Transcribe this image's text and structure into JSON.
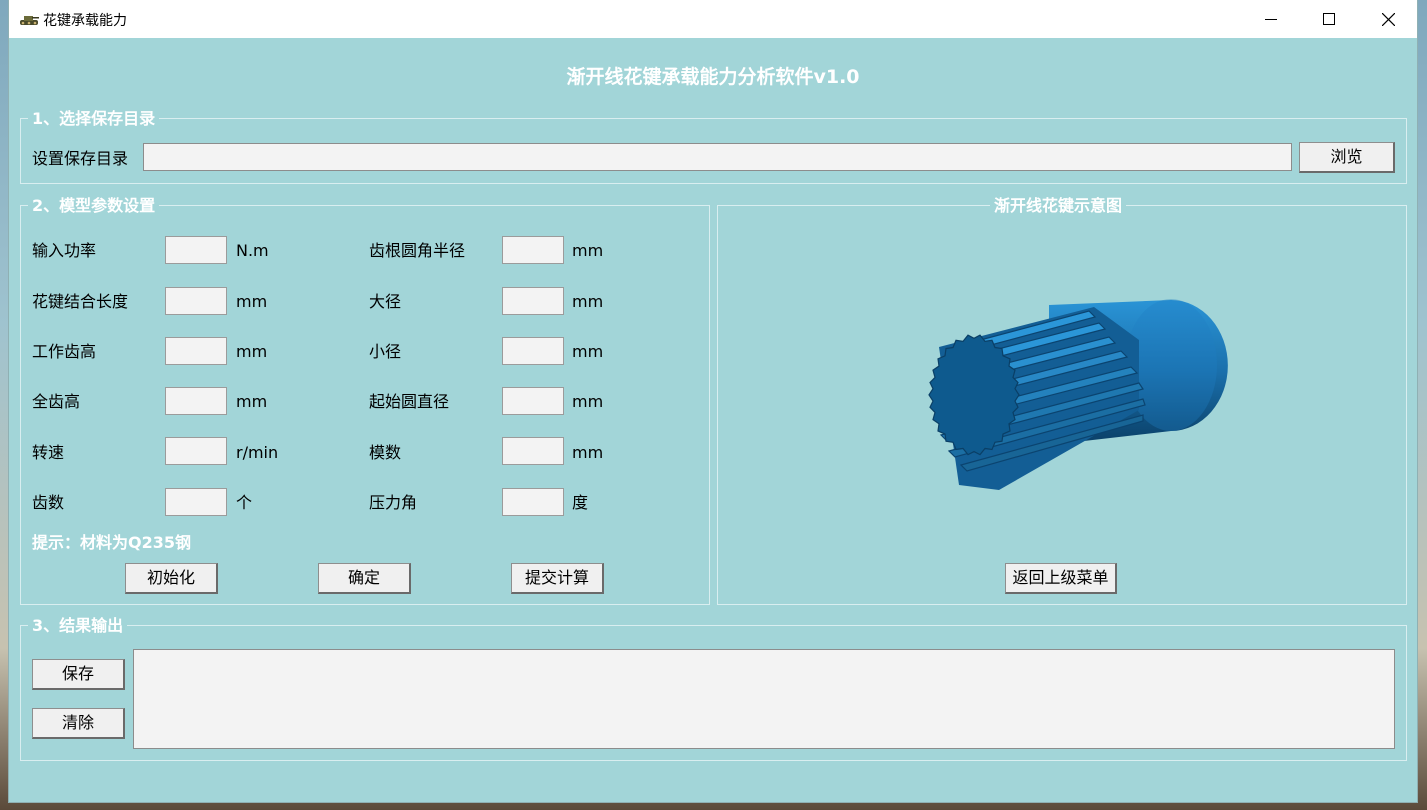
{
  "window": {
    "title": "花键承载能力",
    "controls": [
      "minimize-icon",
      "maximize-icon",
      "close-icon"
    ]
  },
  "header": {
    "title": "渐开线花键承载能力分析软件v1.0"
  },
  "section1": {
    "title": "1、选择保存目录",
    "dir_label": "设置保存目录",
    "dir_value": "",
    "browse_label": "浏览"
  },
  "section2": {
    "title": "2、模型参数设置",
    "left_params": [
      {
        "label": "输入功率",
        "unit": "N.m",
        "value": ""
      },
      {
        "label": "花键结合长度",
        "unit": "mm",
        "value": ""
      },
      {
        "label": "工作齿高",
        "unit": "mm",
        "value": ""
      },
      {
        "label": "全齿高",
        "unit": "mm",
        "value": ""
      },
      {
        "label": "转速",
        "unit": "r/min",
        "value": ""
      },
      {
        "label": "齿数",
        "unit": "个",
        "value": ""
      }
    ],
    "right_params": [
      {
        "label": "齿根圆角半径",
        "unit": "mm",
        "value": ""
      },
      {
        "label": "大径",
        "unit": "mm",
        "value": ""
      },
      {
        "label": "小径",
        "unit": "mm",
        "value": ""
      },
      {
        "label": "起始圆直径",
        "unit": "mm",
        "value": ""
      },
      {
        "label": "模数",
        "unit": "mm",
        "value": ""
      },
      {
        "label": "压力角",
        "unit": "度",
        "value": ""
      }
    ],
    "hint": "提示：材料为Q235钢",
    "buttons": {
      "init": "初始化",
      "confirm": "确定",
      "submit": "提交计算"
    }
  },
  "diagram": {
    "title": "渐开线花键示意图",
    "back_label": "返回上级菜单",
    "colors": {
      "shaft": "#1f7fc4",
      "shaft_dark": "#0d4f7e",
      "face": "#0e5a8e"
    }
  },
  "section3": {
    "title": "3、结果输出",
    "save_label": "保存",
    "clear_label": "清除",
    "output_value": ""
  }
}
